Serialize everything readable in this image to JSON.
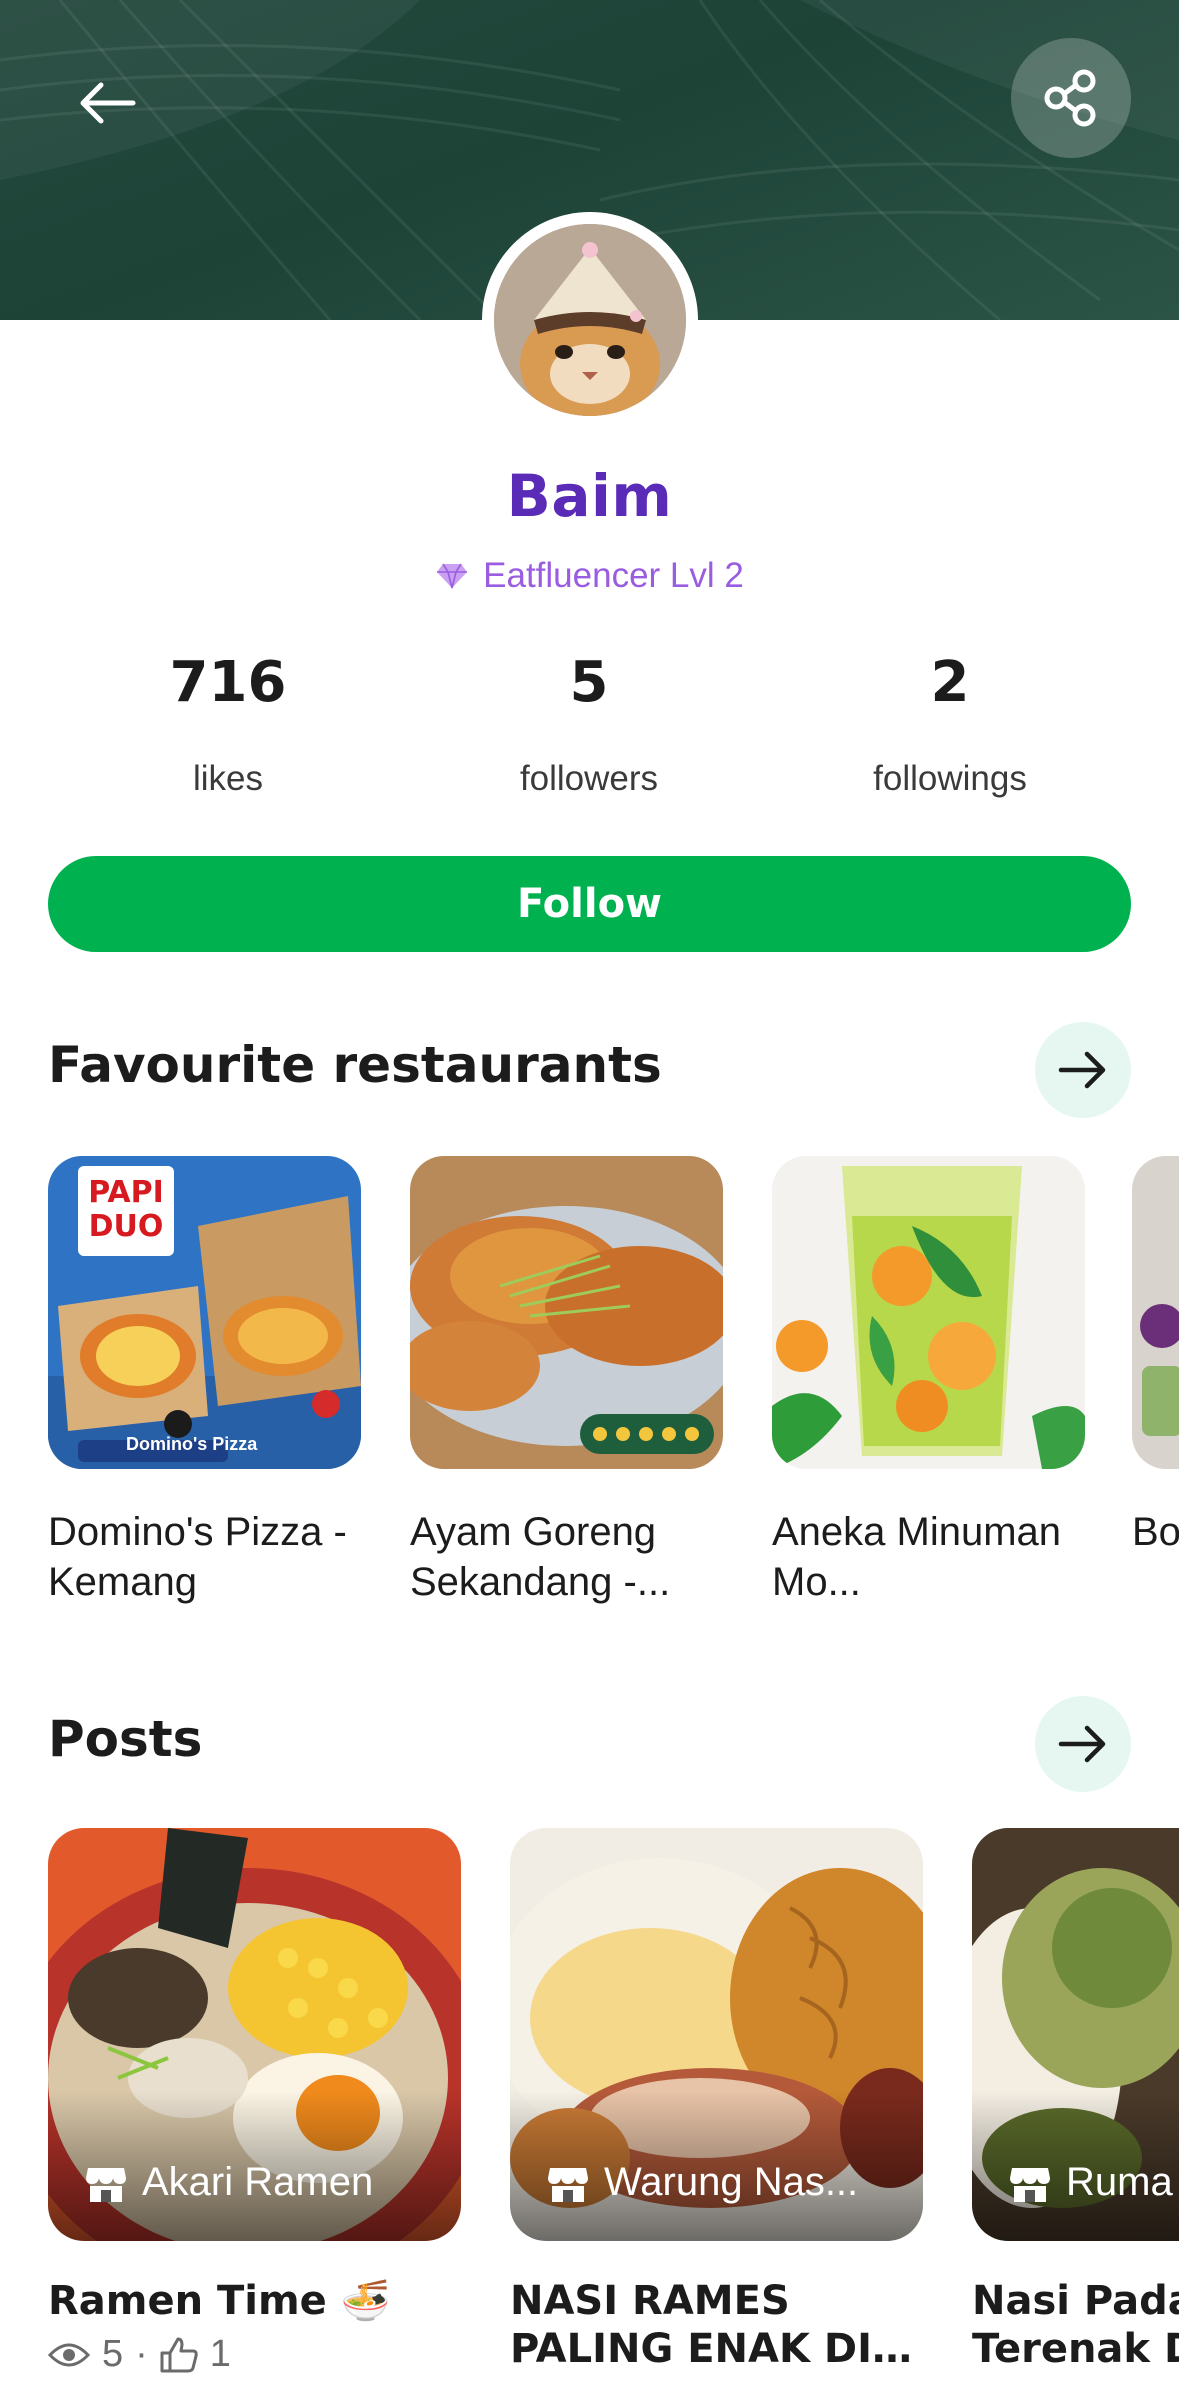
{
  "header": {
    "back_icon": "arrow-left-icon",
    "share_icon": "share-icon"
  },
  "profile": {
    "name": "Baim",
    "level_icon": "diamond-icon",
    "level": "Eatfluencer Lvl 2"
  },
  "stats": [
    {
      "value": "716",
      "label": "likes"
    },
    {
      "value": "5",
      "label": "followers"
    },
    {
      "value": "2",
      "label": "followings"
    }
  ],
  "follow_label": "Follow",
  "favourites": {
    "title": "Favourite restaurants",
    "items": [
      {
        "name": "Domino's Pizza - Kemang",
        "badge": "PAPI DUO",
        "brand": "Domino's Pizza"
      },
      {
        "name": "Ayam Goreng Sekandang -..."
      },
      {
        "name": "Aneka Minuman Mo..."
      },
      {
        "name": "Bo Lu"
      }
    ]
  },
  "posts": {
    "title": "Posts",
    "items": [
      {
        "restaurant": "Akari Ramen",
        "title": "Ramen Time 🍜",
        "title2": "",
        "views": "5",
        "likes": "1"
      },
      {
        "restaurant": "Warung Nas...",
        "title": "NASI RAMES",
        "title2": "PALING ENAK DI C..."
      },
      {
        "restaurant": "Ruma",
        "title": "Nasi Padar",
        "title2": "Terenak Di"
      }
    ]
  },
  "colors": {
    "banner": "#1d4337",
    "name": "#5a2bb6",
    "level": "#9a5ce0",
    "follow": "#00b14f",
    "arrow_bg": "#e6f7f2"
  }
}
